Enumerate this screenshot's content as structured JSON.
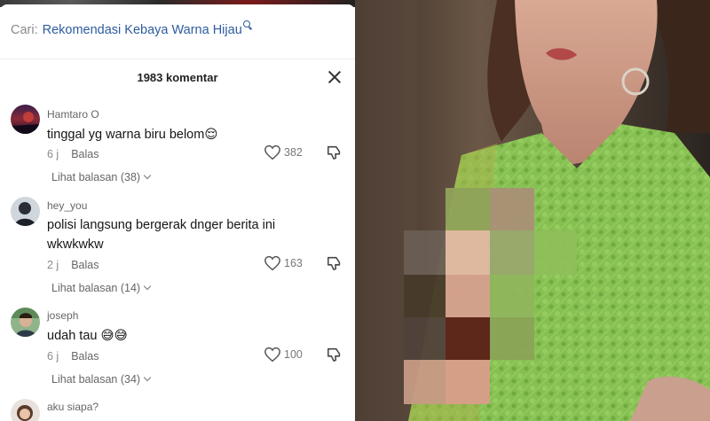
{
  "search": {
    "prefix": "Cari:",
    "query": "Rekomendasi Kebaya Warna Hijau"
  },
  "header": {
    "comment_count": "1983 komentar"
  },
  "comments": [
    {
      "username": "Hamtaro O",
      "text": "tinggal yg warna biru belom😌",
      "time": "6 j",
      "reply": "Balas",
      "likes": "382",
      "view_replies": "Lihat balasan (38)"
    },
    {
      "username": "hey_you",
      "text": "polisi langsung bergerak dnger berita ini wkwkwkw",
      "time": "2 j",
      "reply": "Balas",
      "likes": "163",
      "view_replies": "Lihat balasan (14)"
    },
    {
      "username": "joseph",
      "text": "udah tau 😅😅",
      "time": "6 j",
      "reply": "Balas",
      "likes": "100",
      "view_replies": "Lihat balasan (34)"
    },
    {
      "username": "aku siapa?"
    }
  ],
  "colors": {
    "link_blue": "#2d5c9e",
    "kebaya_green": "#7fb84a"
  },
  "icons": {
    "close": "close-icon",
    "like": "heart-icon",
    "dislike": "dislike-icon",
    "search": "search-icon"
  }
}
